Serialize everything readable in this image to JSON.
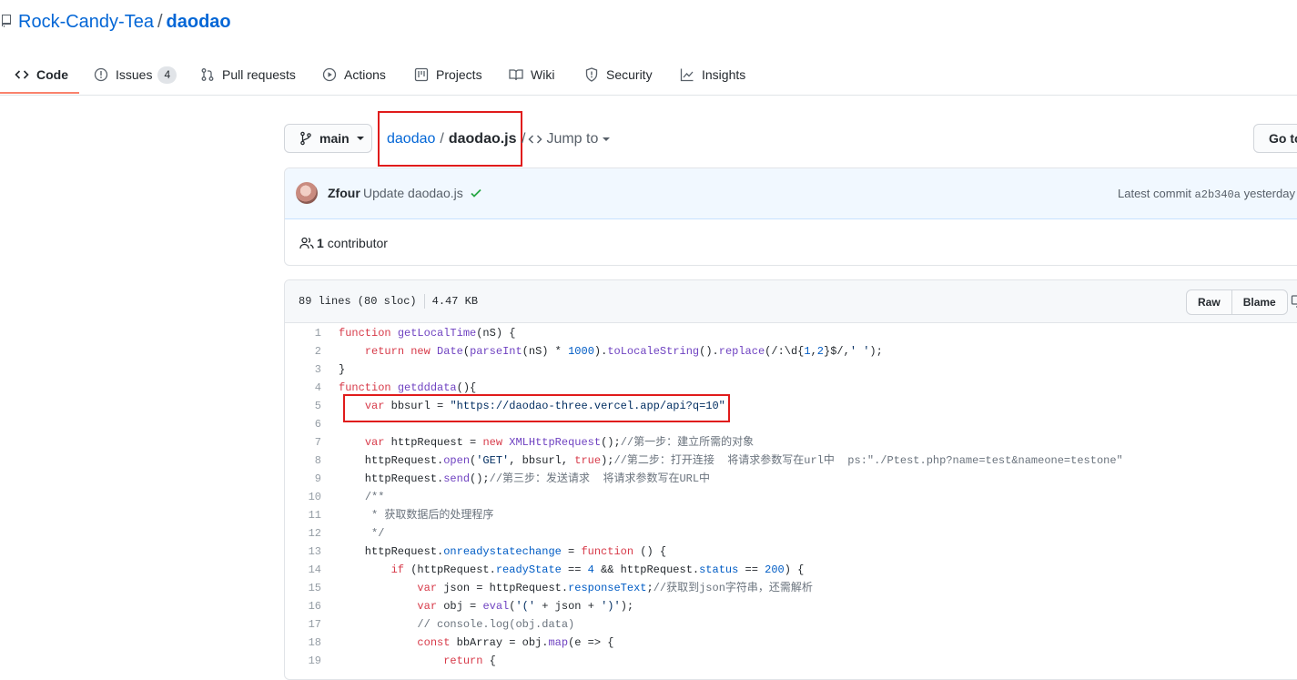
{
  "repo": {
    "owner": "Rock-Candy-Tea",
    "separator": "/",
    "name": "daodao"
  },
  "tabs": [
    {
      "label": "Code",
      "icon": "code-icon",
      "active": true
    },
    {
      "label": "Issues",
      "icon": "issue-icon",
      "count": "4"
    },
    {
      "label": "Pull requests",
      "icon": "pull-request-icon"
    },
    {
      "label": "Actions",
      "icon": "play-icon"
    },
    {
      "label": "Projects",
      "icon": "project-icon"
    },
    {
      "label": "Wiki",
      "icon": "book-icon"
    },
    {
      "label": "Security",
      "icon": "shield-icon"
    },
    {
      "label": "Insights",
      "icon": "graph-icon"
    }
  ],
  "branch": {
    "label": "main",
    "icon": "git-branch-icon"
  },
  "breadcrumb": {
    "repo": "daodao",
    "sep": "/",
    "file": "daodao.js",
    "sep2": "/",
    "jump": "Jump to"
  },
  "goto_button": "Go to",
  "commit": {
    "author": "Zfour",
    "message": "Update daodao.js",
    "latest_label": "Latest commit",
    "sha": "a2b340a",
    "time": "yesterday"
  },
  "contributors": {
    "count": "1",
    "label": "contributor"
  },
  "file": {
    "lines_info": "89 lines (80 sloc)",
    "size": "4.47 KB",
    "raw": "Raw",
    "blame": "Blame"
  },
  "code_lines": [
    "function getLocalTime(nS) {",
    "    return new Date(parseInt(nS) * 1000).toLocaleString().replace(/:\\d{1,2}$/,' ');",
    "}",
    "function getdddata(){",
    "    var bbsurl = \"https://daodao-three.vercel.app/api?q=10\"",
    "",
    "    var httpRequest = new XMLHttpRequest();//第一步：建立所需的对象",
    "    httpRequest.open('GET', bbsurl, true);//第二步：打开连接  将请求参数写在url中  ps:\"./Ptest.php?name=test&nameone=testone\"",
    "    httpRequest.send();//第三步：发送请求  将请求参数写在URL中",
    "    /**",
    "     * 获取数据后的处理程序",
    "     */",
    "    httpRequest.onreadystatechange = function () {",
    "        if (httpRequest.readyState == 4 && httpRequest.status == 200) {",
    "            var json = httpRequest.responseText;//获取到json字符串，还需解析",
    "            var obj = eval('(' + json + ')');",
    "            // console.log(obj.data)",
    "            const bbArray = obj.map(e => {",
    "                return {"
  ],
  "colors": {
    "accent": "#0366d6",
    "highlight": "#e01b1b",
    "tab_underline": "#f9826c"
  }
}
